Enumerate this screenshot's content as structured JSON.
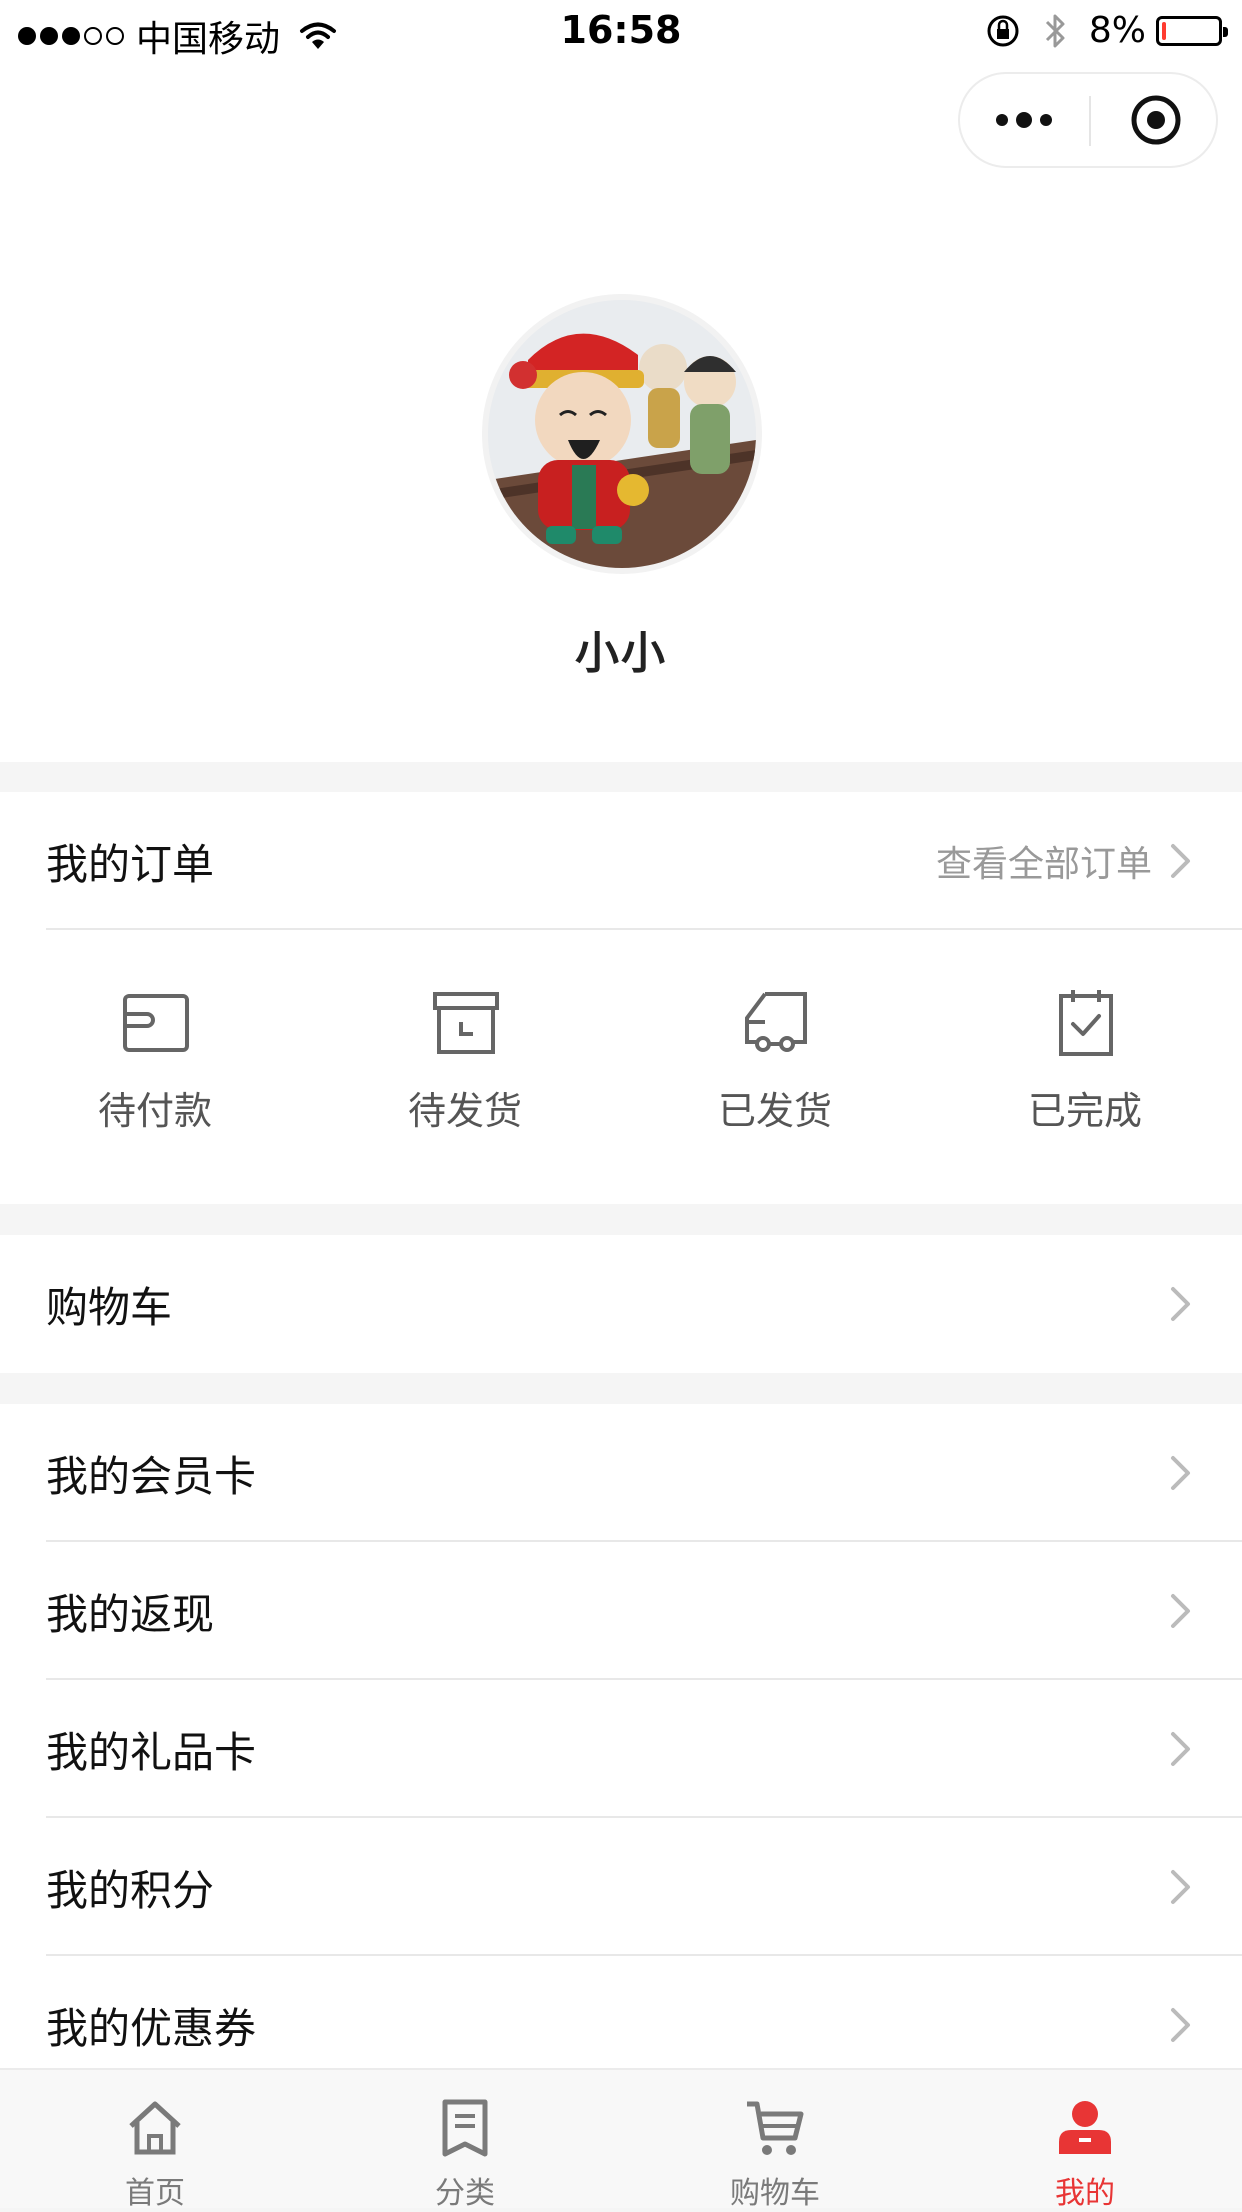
{
  "status_bar": {
    "carrier": "中国移动",
    "time": "16:58",
    "battery": "8%",
    "battery_level": 0.08
  },
  "profile": {
    "username": "小小"
  },
  "orders": {
    "title": "我的订单",
    "view_all": "查看全部订单",
    "statuses": [
      {
        "label": "待付款",
        "icon": "wallet-icon"
      },
      {
        "label": "待发货",
        "icon": "box-icon"
      },
      {
        "label": "已发货",
        "icon": "truck-icon"
      },
      {
        "label": "已完成",
        "icon": "clipboard-check-icon"
      }
    ]
  },
  "cart_row": {
    "label": "购物车"
  },
  "menu": {
    "items": [
      {
        "label": "我的会员卡"
      },
      {
        "label": "我的返现"
      },
      {
        "label": "我的礼品卡"
      },
      {
        "label": "我的积分"
      },
      {
        "label": "我的优惠券"
      }
    ]
  },
  "tabbar": {
    "tabs": [
      {
        "label": "首页",
        "icon": "home-icon"
      },
      {
        "label": "分类",
        "icon": "list-icon"
      },
      {
        "label": "购物车",
        "icon": "cart-icon"
      },
      {
        "label": "我的",
        "icon": "user-icon"
      }
    ],
    "active_index": 3
  },
  "colors": {
    "accent": "#e83535",
    "background": "#f5f5f5",
    "text_secondary": "#999999"
  }
}
